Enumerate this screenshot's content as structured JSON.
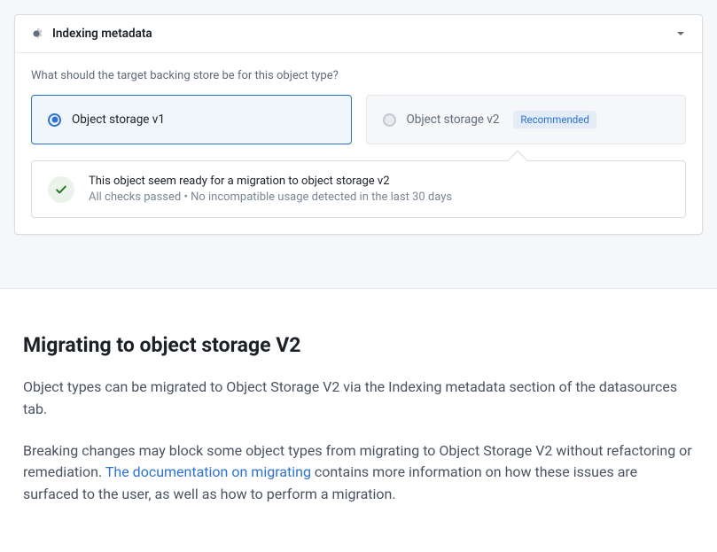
{
  "panel": {
    "title": "Indexing metadata",
    "question": "What should the target backing store be for this object type?",
    "options": [
      {
        "label": "Object storage v1",
        "selected": true
      },
      {
        "label": "Object storage v2",
        "selected": false,
        "badge": "Recommended"
      }
    ],
    "status": {
      "primary": "This object seem ready for a migration to object storage v2",
      "secondary": "All checks passed • No incompatible usage detected in the last 30 days"
    }
  },
  "doc": {
    "heading": "Migrating to object storage V2",
    "para1": "Object types can be migrated to Object Storage V2 via the Indexing metadata section of the datasources tab.",
    "para2_a": "Breaking changes may block some object types from migrating to Object Storage V2 without refactoring or remediation. ",
    "para2_link": "The documentation on migrating ",
    "para2_b": " contains more information on how these issues are surfaced to the user, as well as how to perform a migration."
  }
}
